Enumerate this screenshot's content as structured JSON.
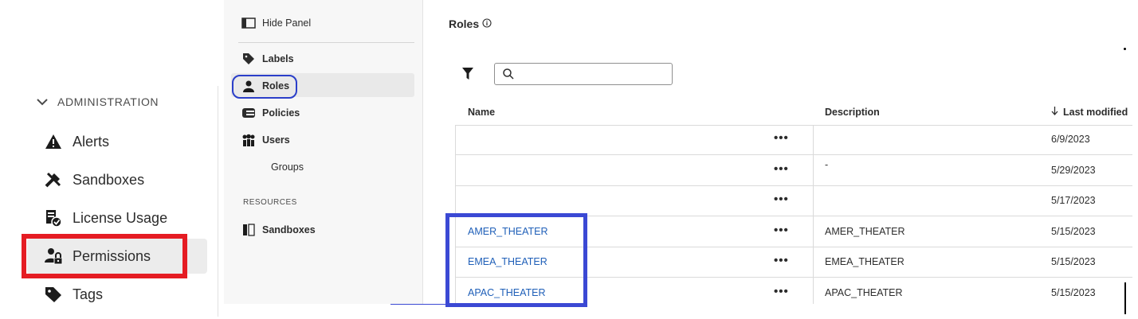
{
  "sidebar": {
    "section_label": "ADMINISTRATION",
    "items": [
      {
        "label": "Alerts",
        "icon": "alert-icon"
      },
      {
        "label": "Sandboxes",
        "icon": "sandbox-tools-icon"
      },
      {
        "label": "License Usage",
        "icon": "license-usage-icon"
      },
      {
        "label": "Permissions",
        "icon": "permissions-icon"
      },
      {
        "label": "Tags",
        "icon": "tag-icon"
      }
    ]
  },
  "panel": {
    "hide_label": "Hide Panel",
    "items": [
      {
        "label": "Labels",
        "icon": "label-icon"
      },
      {
        "label": "Roles",
        "icon": "user-icon"
      },
      {
        "label": "Policies",
        "icon": "policies-icon"
      },
      {
        "label": "Users",
        "icon": "users-icon"
      }
    ],
    "sub_item": "Groups",
    "resources_label": "RESOURCES",
    "resources_items": [
      {
        "label": "Sandboxes",
        "icon": "sandbox-icon"
      }
    ]
  },
  "main": {
    "title": "Roles",
    "search": {
      "value": "",
      "placeholder": ""
    },
    "columns": {
      "name": "Name",
      "description": "Description",
      "last_modified": "Last modified"
    },
    "rows": [
      {
        "name": "",
        "actions": "•••",
        "description": "",
        "modified": "6/9/2023"
      },
      {
        "name": "",
        "actions": "•••",
        "description": "-",
        "modified": "5/29/2023"
      },
      {
        "name": "",
        "actions": "•••",
        "description": "",
        "modified": "5/17/2023"
      },
      {
        "name": "AMER_THEATER",
        "actions": "•••",
        "description": "AMER_THEATER",
        "modified": "5/15/2023"
      },
      {
        "name": "EMEA_THEATER",
        "actions": "•••",
        "description": "EMEA_THEATER",
        "modified": "5/15/2023"
      },
      {
        "name": "APAC_THEATER",
        "actions": "•••",
        "description": "APAC_THEATER",
        "modified": "5/15/2023"
      }
    ]
  },
  "colors": {
    "highlight_red": "#e51c23",
    "highlight_blue": "#3b49d4",
    "link": "#1f5fb8"
  }
}
